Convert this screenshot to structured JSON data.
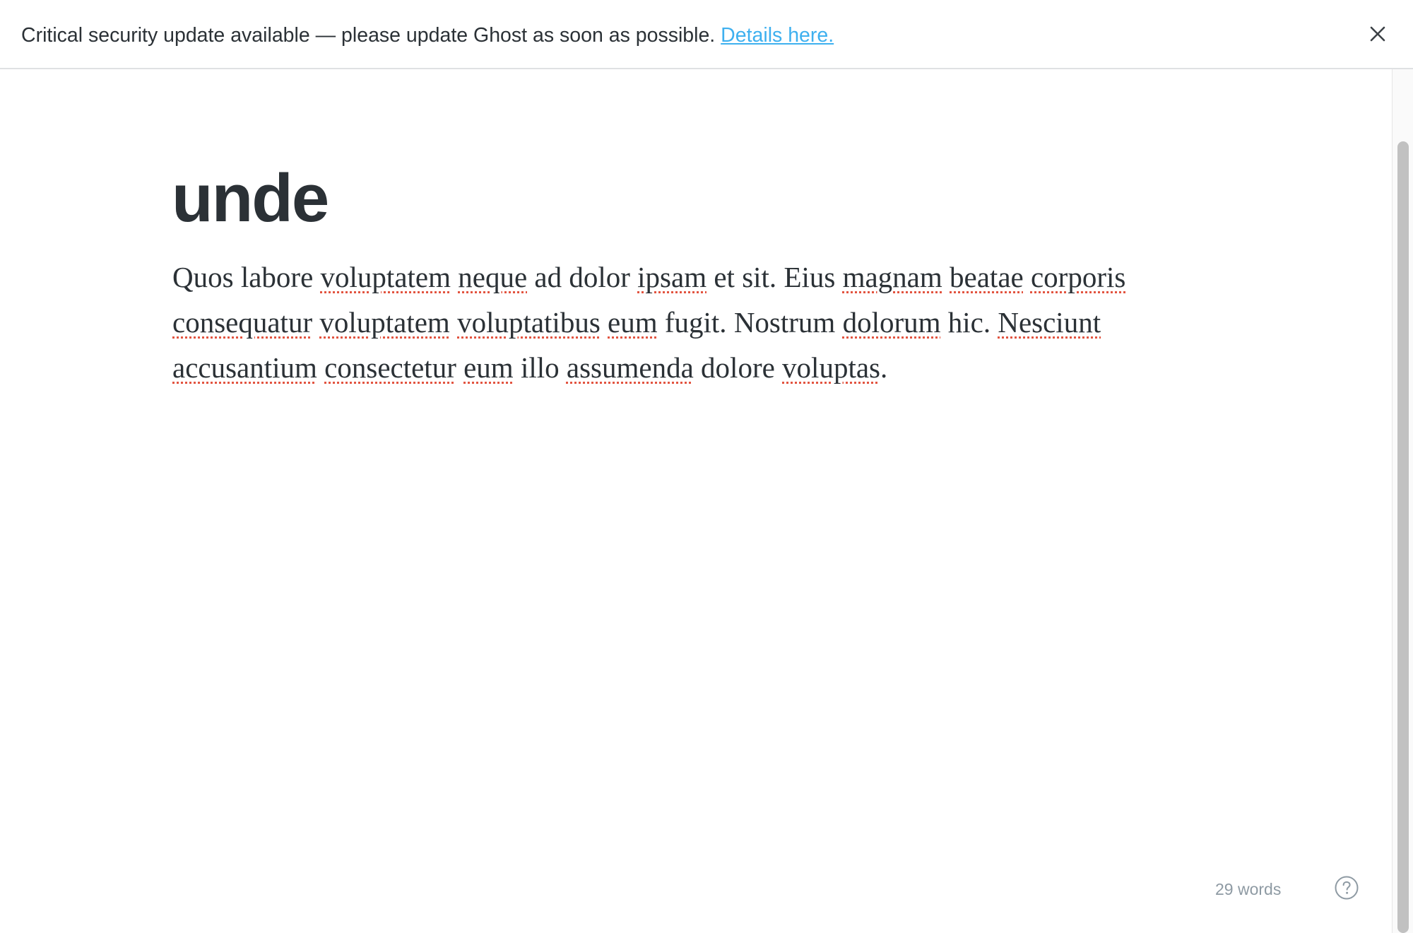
{
  "banner": {
    "message": "Critical security update available — please update Ghost as soon as possible.",
    "link_label": "Details here.",
    "close_icon": "close-icon"
  },
  "editor": {
    "title": "unde",
    "body_words": [
      {
        "text": "Quos",
        "misspelled": false
      },
      {
        "text": "labore",
        "misspelled": false
      },
      {
        "text": "voluptatem",
        "misspelled": true
      },
      {
        "text": "neque",
        "misspelled": true
      },
      {
        "text": "ad",
        "misspelled": false
      },
      {
        "text": "dolor",
        "misspelled": false
      },
      {
        "text": "ipsam",
        "misspelled": true
      },
      {
        "text": "et",
        "misspelled": false
      },
      {
        "text": "sit.",
        "misspelled": false
      },
      {
        "text": "Eius",
        "misspelled": false
      },
      {
        "text": "magnam",
        "misspelled": true
      },
      {
        "text": "beatae",
        "misspelled": true
      },
      {
        "text": "corporis",
        "misspelled": true
      },
      {
        "text": "consequatur",
        "misspelled": true
      },
      {
        "text": "voluptatem",
        "misspelled": true
      },
      {
        "text": "voluptatibus",
        "misspelled": true
      },
      {
        "text": "eum",
        "misspelled": true
      },
      {
        "text": "fugit.",
        "misspelled": false
      },
      {
        "text": "Nostrum",
        "misspelled": false
      },
      {
        "text": "dolorum",
        "misspelled": true
      },
      {
        "text": "hic.",
        "misspelled": false
      },
      {
        "text": "Nesciunt",
        "misspelled": true
      },
      {
        "text": "accusantium",
        "misspelled": true
      },
      {
        "text": "consectetur",
        "misspelled": true
      },
      {
        "text": "eum",
        "misspelled": true
      },
      {
        "text": "illo",
        "misspelled": false
      },
      {
        "text": "assumenda",
        "misspelled": true
      },
      {
        "text": "dolore",
        "misspelled": false
      },
      {
        "text": "voluptas",
        "misspelled": true,
        "suffix": "."
      }
    ]
  },
  "status": {
    "word_count": "29 words",
    "help_icon": "help-icon"
  },
  "colors": {
    "link": "#3eb0ef",
    "text": "#2b3136",
    "muted": "#8e9aa3",
    "spellcheck": "#e25440"
  }
}
